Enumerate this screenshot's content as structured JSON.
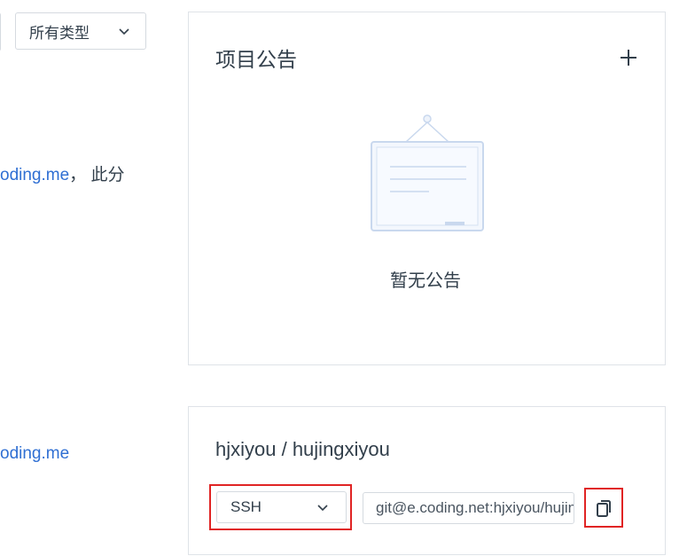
{
  "filter": {
    "type_select_value": "所有类型"
  },
  "left_column": {
    "line1_link": "oding.me",
    "line1_suffix": "，  此分",
    "line2_link": "oding.me"
  },
  "notice": {
    "title": "项目公告",
    "empty_text": "暂无公告"
  },
  "repo": {
    "path": "hjxiyou / hujingxiyou",
    "protocol_value": "SSH",
    "clone_url": "git@e.coding.net:hjxiyou/hujingxiyou.git"
  },
  "icons": {
    "chevron": "chevron-down-icon",
    "plus": "plus-icon",
    "copy": "copy-icon",
    "illustration": "notice-board-illustration"
  },
  "colors": {
    "link": "#2f6fd3",
    "highlight_border": "#e02424",
    "panel_border": "#dfe3e8",
    "text": "#323f4b"
  }
}
